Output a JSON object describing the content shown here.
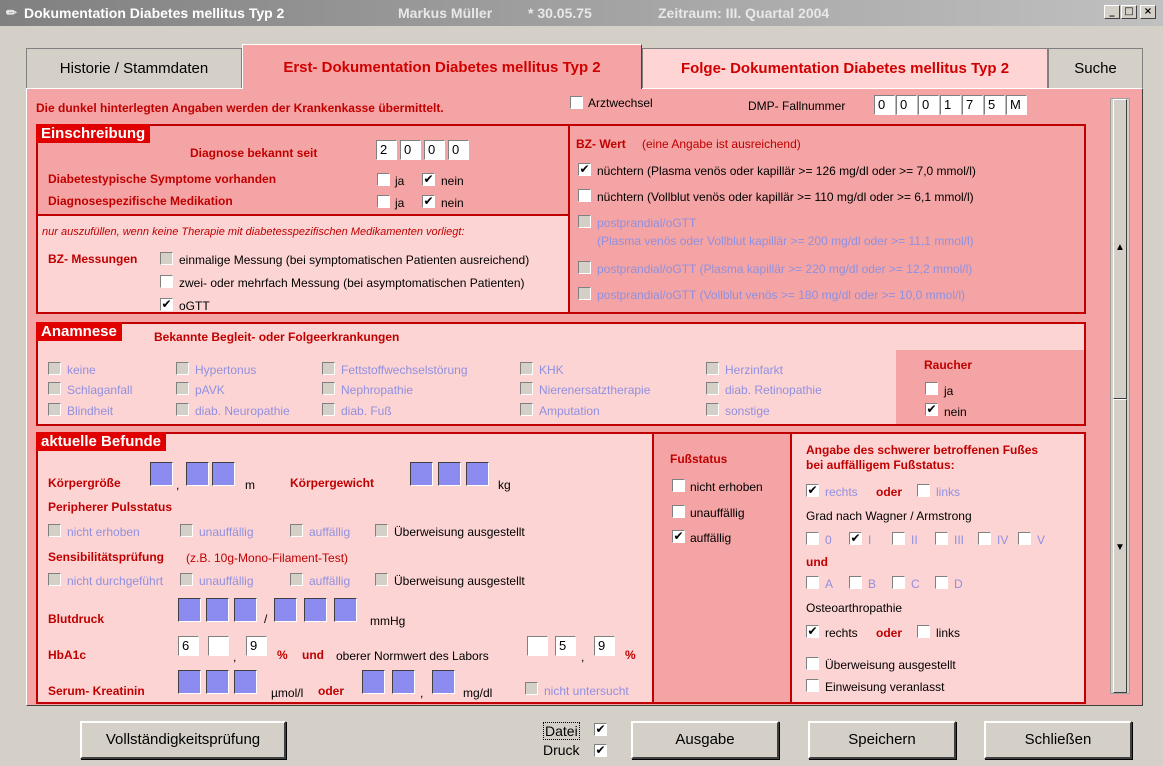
{
  "window": {
    "title": "Dokumentation Diabetes mellitus Typ 2",
    "patient": "Markus Müller",
    "dob": "* 30.05.75",
    "period": "Zeitraum: III. Quartal 2004",
    "minimize": "_",
    "maximize": "□",
    "close": "×"
  },
  "tabs": [
    "Historie / Stammdaten",
    "Erst- Dokumentation Diabetes mellitus Typ 2",
    "Folge- Dokumentation Diabetes mellitus Typ 2",
    "Suche"
  ],
  "top": {
    "notice": "Die dunkel hinterlegten Angaben werden der Krankenkasse übermittelt.",
    "arztwechsel": "Arztwechsel",
    "dmp_label": "DMP- Fallnummer",
    "dmp_digits": [
      "0",
      "0",
      "0",
      "1",
      "7",
      "5",
      "M"
    ]
  },
  "einschreibung": {
    "title": "Einschreibung",
    "diagnose_label": "Diagnose bekannt seit",
    "year": [
      "2",
      "0",
      "0",
      "0"
    ],
    "symptome": "Diabetestypische Symptome vorhanden",
    "medikation": "Diagnosespezifische Medikation",
    "ja": "ja",
    "nein": "nein",
    "note": "nur auszufüllen, wenn keine Therapie mit diabetesspezifischen Medikamenten vorliegt:",
    "bz_mess": "BZ- Messungen",
    "mess": [
      "einmalige Messung (bei symptomatischen Patienten ausreichend)",
      "zwei- oder mehrfach Messung (bei asymptomatischen Patienten)",
      "oGTT"
    ]
  },
  "bzwert": {
    "title": "BZ- Wert",
    "hint": "(eine Angabe ist ausreichend)",
    "items": [
      "nüchtern (Plasma venös oder kapillär >= 126 mg/dl oder >= 7,0 mmol/l)",
      "nüchtern (Vollblut venös oder kapillär >= 110 mg/dl oder >= 6,1 mmol/l)",
      "postprandial/oGTT",
      "(Plasma venös oder Vollblut kapillär >= 200 mg/dl oder >= 11,1 mmol/l)",
      "postprandial/oGTT (Plasma kapillär >= 220 mg/dl oder >= 12,2 mmol/l)",
      "postprandial/oGTT (Vollblut venös >= 180 mg/dl oder >= 10,0 mmol/l)"
    ]
  },
  "anamnese": {
    "title": "Anamnese",
    "subtitle": "Bekannte Begleit- oder Folgeerkrankungen",
    "items": [
      "keine",
      "Hypertonus",
      "Fettstoffwechselstörung",
      "KHK",
      "Herzinfarkt",
      "Schlaganfall",
      "pAVK",
      "Nephropathie",
      "Nierenersatztherapie",
      "diab. Retinopathie",
      "Blindheit",
      "diab. Neuropathie",
      "diab. Fuß",
      "Amputation",
      "sonstige"
    ],
    "raucher": "Raucher",
    "ja": "ja",
    "nein": "nein"
  },
  "befunde": {
    "title": "aktuelle Befunde",
    "groesse": "Körpergröße",
    "m": "m",
    "gewicht": "Körpergewicht",
    "kg": "kg",
    "puls": "Peripherer Pulsstatus",
    "puls_opts": [
      "nicht erhoben",
      "unauffällig",
      "auffällig",
      "Überweisung ausgestellt"
    ],
    "sens": "Sensibilitätsprüfung",
    "sens_hint": "(z.B. 10g-Mono-Filament-Test)",
    "sens_opts": [
      "nicht durchgeführt",
      "unauffällig",
      "auffällig",
      "Überweisung ausgestellt"
    ],
    "blutdruck": "Blutdruck",
    "mmhg": "mmHg",
    "hba1c": "HbA1c",
    "hb1": "6",
    "hb2": "",
    "hb3": "9",
    "pct": "%",
    "und": "und",
    "norm": "oberer Normwert des Labors",
    "n1": "",
    "n2": "5",
    "n3": "9",
    "kreat": "Serum- Kreatinin",
    "umol": "µmol/l",
    "oder": "oder",
    "mgdl": "mg/dl",
    "nicht_unt": "nicht untersucht",
    "sep": ",",
    "slash": "/"
  },
  "fuss": {
    "title": "Fußstatus",
    "opts": [
      "nicht erhoben",
      "unauffällig",
      "auffällig"
    ]
  },
  "angabe": {
    "title1": "Angabe des schwerer betroffenen Fußes",
    "title2": "bei auffälligem Fußstatus:",
    "rechts": "rechts",
    "oder": "oder",
    "links": "links",
    "wagner": "Grad nach Wagner / Armstrong",
    "grades": [
      "0",
      "I",
      "II",
      "III",
      "IV",
      "V"
    ],
    "und": "und",
    "letters": [
      "A",
      "B",
      "C",
      "D"
    ],
    "osteo": "Osteoarthropathie",
    "ueber": "Überweisung ausgestellt",
    "einw": "Einweisung veranlasst"
  },
  "footer": {
    "vollst": "Vollständigkeitsprüfung",
    "datei": "Datei",
    "druck": "Druck",
    "ausgabe": "Ausgabe",
    "speichern": "Speichern",
    "schliessen": "Schließen"
  },
  "check": "✔",
  "scroll_up": "▲",
  "scroll_down": "▼"
}
